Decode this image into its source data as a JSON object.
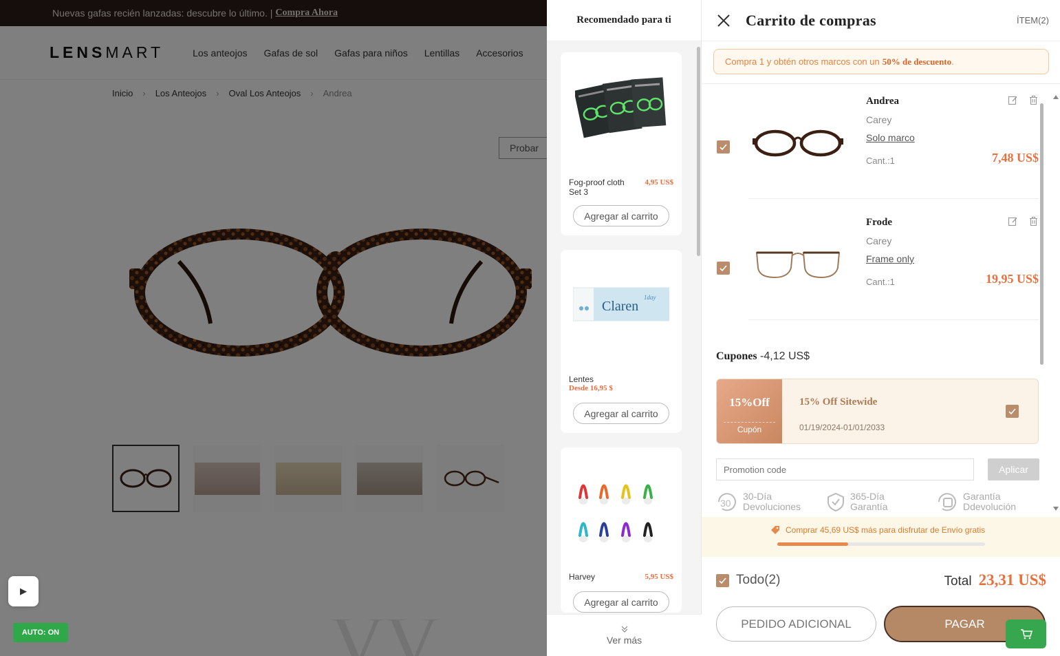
{
  "background_page": {
    "promo_text": "Nuevas gafas recién lanzadas: descubre lo último. |",
    "promo_link": "Compra Ahora",
    "logo_bold": "LENS",
    "logo_light": "MART",
    "nav": [
      "Los anteojos",
      "Gafas de sol",
      "Gafas para niños",
      "Lentillas",
      "Accesorios"
    ],
    "breadcrumb": [
      "Inicio",
      "Los Anteojos",
      "Oval Los Anteojos",
      "Andrea"
    ],
    "try_button": "Probar",
    "auto_badge": "AUTO: ON"
  },
  "recommended": {
    "title": "Recomendado para ti",
    "items": [
      {
        "name": "Fog-proof cloth Set 3",
        "price": "4,95 US$",
        "add_label": "Agregar al carrito",
        "image": "cloth-packs"
      },
      {
        "name": "Lentes",
        "price": "Desde 16,95 $",
        "add_label": "Agregar al carrito",
        "image": "contact-lens-box"
      },
      {
        "name": "Harvey",
        "price": "5,95 US$",
        "add_label": "Agregar al carrito",
        "image": "nose-pad-clips"
      }
    ],
    "more_label": "Ver más"
  },
  "cart": {
    "title": "Carrito de compras",
    "item_count": "ÍTEM(2)",
    "discount_prefix": "Compra 1 y obtén otros marcos con un",
    "discount_highlight": "50% de descuento",
    "discount_suffix": ".",
    "items": [
      {
        "name": "Andrea",
        "color": "Carey",
        "option": "Solo marco",
        "qty": "Cant.:1",
        "price": "7,48 US$",
        "checked": true
      },
      {
        "name": "Frode",
        "color": "Carey",
        "option": "Frame only",
        "qty": "Cant.:1",
        "price": "19,95 US$",
        "checked": true
      }
    ],
    "coupons_label": "Cupones",
    "coupons_amount": "-4,12 US$",
    "coupon": {
      "badge": "15%Off",
      "badge_sub": "Cupón",
      "title": "15% Off Sitewide",
      "dates": "01/19/2024-01/01/2033",
      "checked": true
    },
    "promo_placeholder": "Promotion code",
    "apply_label": "Aplicar",
    "guarantees": [
      {
        "icon": "return-30-icon",
        "line1": "30-Día",
        "line2": "Devoluciones"
      },
      {
        "icon": "shield-check-icon",
        "line1": "365-Día",
        "line2": "Garantía"
      },
      {
        "icon": "refund-icon",
        "line1": "Garantía",
        "line2": "Ddevolución"
      }
    ],
    "free_shipping_text": "Comprar 45,69 US$ más para disfrutar de Envío gratis",
    "free_shipping_progress": 0.34,
    "select_all": "Todo(2)",
    "total_label": "Total",
    "total_value": "23,31 US$",
    "extra_order_label": "PEDIDO ADICIONAL",
    "pay_label": "PAGAR"
  },
  "colors": {
    "accent": "#e8703c",
    "brown": "#b58866",
    "fab_green": "#36a74f"
  }
}
